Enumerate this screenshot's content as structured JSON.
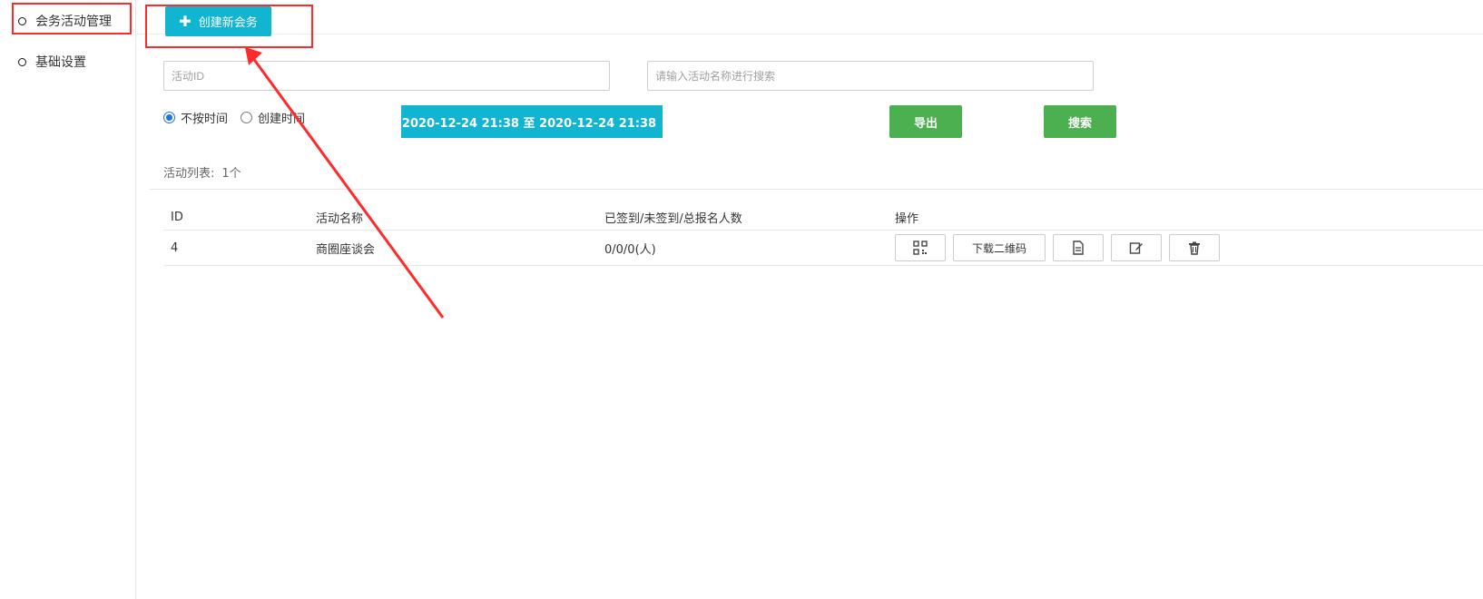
{
  "sidebar": {
    "items": [
      {
        "label": "会务活动管理"
      },
      {
        "label": "基础设置"
      }
    ]
  },
  "toolbar": {
    "create_label": "创建新会务"
  },
  "filters": {
    "activity_id_placeholder": "活动ID",
    "activity_name_placeholder": "请输入活动名称进行搜索",
    "time_options": [
      {
        "label": "不按时间",
        "checked": true
      },
      {
        "label": "创建时间",
        "checked": false
      }
    ],
    "date_range": "2020-12-24 21:38 至 2020-12-24 21:38",
    "export_label": "导出",
    "search_label": "搜索"
  },
  "list": {
    "summary_label": "活动列表:",
    "summary_count": "1个",
    "columns": [
      "ID",
      "活动名称",
      "已签到/未签到/总报名人数",
      "操作"
    ],
    "rows": [
      {
        "id": "4",
        "name": "商圈座谈会",
        "counts": "0/0/0(人)",
        "actions": {
          "download_qr_label": "下载二维码"
        }
      }
    ]
  },
  "colors": {
    "primary_cyan": "#12b5cf",
    "green": "#4caf50",
    "annotation_red": "#ff2a2a",
    "radio_blue": "#1a73e8"
  },
  "icons": {
    "create": "plus-icon",
    "calendar": "calendar-icon",
    "qr": "qr-code-icon",
    "document": "document-icon",
    "edit": "edit-icon",
    "delete": "trash-icon"
  }
}
